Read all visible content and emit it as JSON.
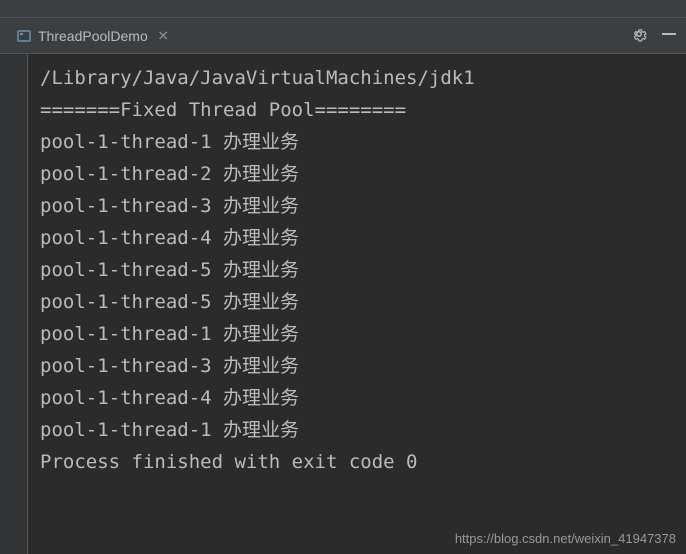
{
  "tab": {
    "title": "ThreadPoolDemo"
  },
  "console": {
    "lines": [
      "/Library/Java/JavaVirtualMachines/jdk1",
      "=======Fixed Thread Pool========",
      "pool-1-thread-1 办理业务",
      "pool-1-thread-2 办理业务",
      "pool-1-thread-3 办理业务",
      "pool-1-thread-4 办理业务",
      "pool-1-thread-5 办理业务",
      "pool-1-thread-5 办理业务",
      "pool-1-thread-1 办理业务",
      "pool-1-thread-3 办理业务",
      "pool-1-thread-4 办理业务",
      "pool-1-thread-1 办理业务",
      "",
      "Process finished with exit code 0"
    ]
  },
  "watermark": "https://blog.csdn.net/weixin_41947378"
}
